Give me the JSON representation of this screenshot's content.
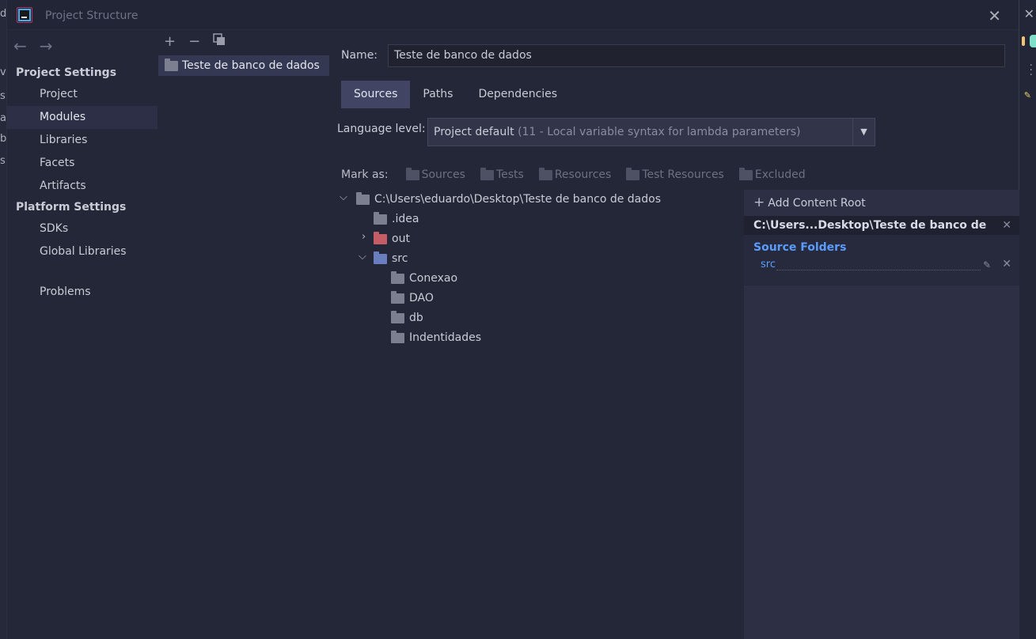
{
  "window": {
    "title": "Project Structure"
  },
  "background": {
    "left_letters": [
      "d",
      "v",
      "s",
      "a",
      "b",
      "s"
    ]
  },
  "nav": {
    "sections": [
      {
        "header": "Project Settings",
        "items": [
          "Project",
          "Modules",
          "Libraries",
          "Facets",
          "Artifacts"
        ]
      },
      {
        "header": "Platform Settings",
        "items": [
          "SDKs",
          "Global Libraries"
        ]
      }
    ],
    "problems": "Problems",
    "selected": "Modules"
  },
  "modules": {
    "toolbar": {
      "add": "+",
      "remove": "−",
      "copy": "copy"
    },
    "items": [
      "Teste de banco de dados"
    ]
  },
  "detail": {
    "name_label": "Name:",
    "name_value": "Teste de banco de dados",
    "tabs": [
      "Sources",
      "Paths",
      "Dependencies"
    ],
    "active_tab": "Sources",
    "language_label": "Language level:",
    "language_value": "Project default",
    "language_hint": "(11 - Local variable syntax for lambda parameters)",
    "mark_as_label": "Mark as:",
    "mark_as_buttons": [
      {
        "label": "Sources",
        "mnemonic": "S",
        "icon": "sources-folder-icon"
      },
      {
        "label": "Tests",
        "mnemonic": "T",
        "icon": "tests-folder-icon"
      },
      {
        "label": "Resources",
        "mnemonic": "",
        "icon": "resources-folder-icon"
      },
      {
        "label": "Test Resources",
        "mnemonic": "",
        "icon": "test-resources-folder-icon"
      },
      {
        "label": "Excluded",
        "mnemonic": "E",
        "icon": "excluded-folder-icon"
      }
    ],
    "tree": {
      "root": "C:\\Users\\eduardo\\Desktop\\Teste de banco de dados",
      "children": [
        {
          "name": ".idea",
          "expanded": null,
          "kind": "plain"
        },
        {
          "name": "out",
          "expanded": false,
          "kind": "excluded"
        },
        {
          "name": "src",
          "expanded": true,
          "kind": "source",
          "children": [
            "Conexao",
            "DAO",
            "db",
            "Indentidades"
          ]
        }
      ]
    }
  },
  "content_root": {
    "add_label": "Add Content Root",
    "path": "C:\\Users...Desktop\\Teste de banco de dados",
    "source_folders_title": "Source Folders",
    "source_folders": [
      "src"
    ]
  },
  "colors": {
    "background": "#242738",
    "selected": "#353852",
    "tab_active": "#414563",
    "source_folder": "#6a7dbf",
    "excluded_folder": "#c55c66",
    "link": "#5b9cff"
  }
}
